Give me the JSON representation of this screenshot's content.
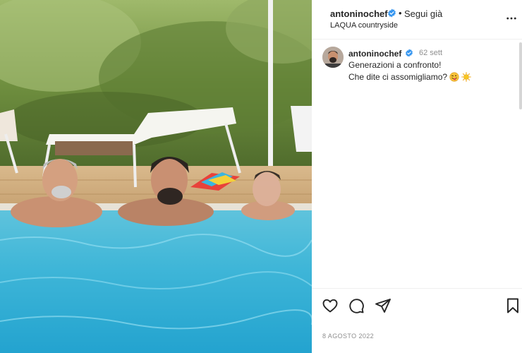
{
  "post": {
    "image_alt": "Three people in a swimming pool in the countryside"
  },
  "header": {
    "username": "antoninochef",
    "follow_separator": "•",
    "follow_label": "Segui già",
    "location": "LAQUA countryside",
    "more_icon": "more-horizontal-icon",
    "verified_color": "#3897f0"
  },
  "comment": {
    "username": "antoninochef",
    "time": "62 sett",
    "text_line1": "Generazioni a confronto!",
    "text_line2": "Che dite ci assomigliamo?",
    "emojis": [
      "winking-tongue-emoji",
      "sun-emoji"
    ]
  },
  "actions": {
    "like_icon": "heart-icon",
    "comment_icon": "comment-icon",
    "share_icon": "send-icon",
    "save_icon": "bookmark-icon"
  },
  "date": "8 AGOSTO 2022"
}
